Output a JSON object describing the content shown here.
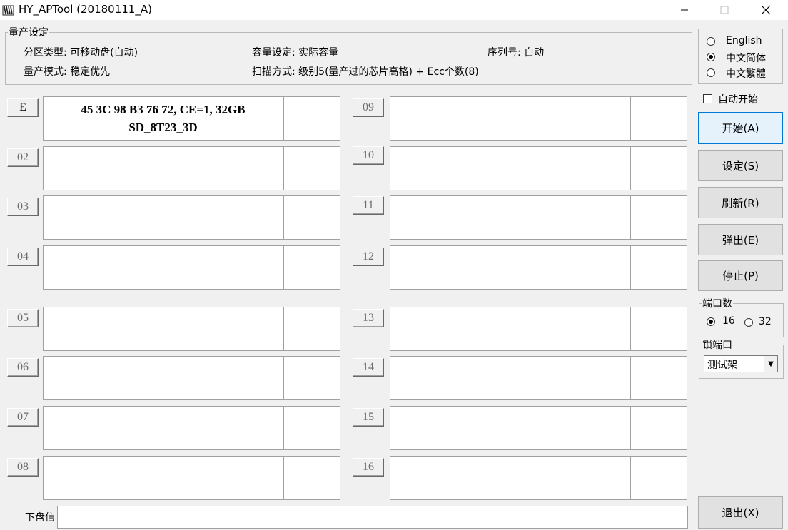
{
  "window": {
    "title": "HY_APTool (20180111_A)"
  },
  "settings": {
    "legend": "量产设定",
    "partition_type": "分区类型: 可移动盘(自动)",
    "capacity": "容量设定: 实际容量",
    "serial": "序列号:  自动",
    "mode": "量产模式: 稳定优先",
    "scan": "扫描方式: 级别5(量产过的芯片高格) + Ecc个数(8)"
  },
  "language": {
    "options": [
      "English",
      "中文简体",
      "中文繁體"
    ],
    "selected": "中文简体"
  },
  "ports": [
    {
      "label": "E",
      "active": true,
      "line1": "45 3C 98 B3 76 72, CE=1, 32GB",
      "line2": "SD_8T23_3D"
    },
    {
      "label": "02"
    },
    {
      "label": "03"
    },
    {
      "label": "04"
    },
    {
      "label": "05"
    },
    {
      "label": "06"
    },
    {
      "label": "07"
    },
    {
      "label": "08"
    },
    {
      "label": "09"
    },
    {
      "label": "10"
    },
    {
      "label": "11"
    },
    {
      "label": "12"
    },
    {
      "label": "13"
    },
    {
      "label": "14"
    },
    {
      "label": "15"
    },
    {
      "label": "16"
    }
  ],
  "controls": {
    "auto_start": "自动开始",
    "start": "开始(A)",
    "settings": "设定(S)",
    "refresh": "刷新(R)",
    "eject": "弹出(E)",
    "stop": "停止(P)",
    "exit": "退出(X)"
  },
  "port_count": {
    "legend": "端口数",
    "options": [
      "16",
      "32"
    ],
    "selected": "16"
  },
  "lock_port": {
    "legend": "锁端口",
    "value": "测试架"
  },
  "bottom": {
    "label": "下盘信"
  },
  "colors": {
    "accent": "#0078d7",
    "background": "#f0f0f0"
  }
}
